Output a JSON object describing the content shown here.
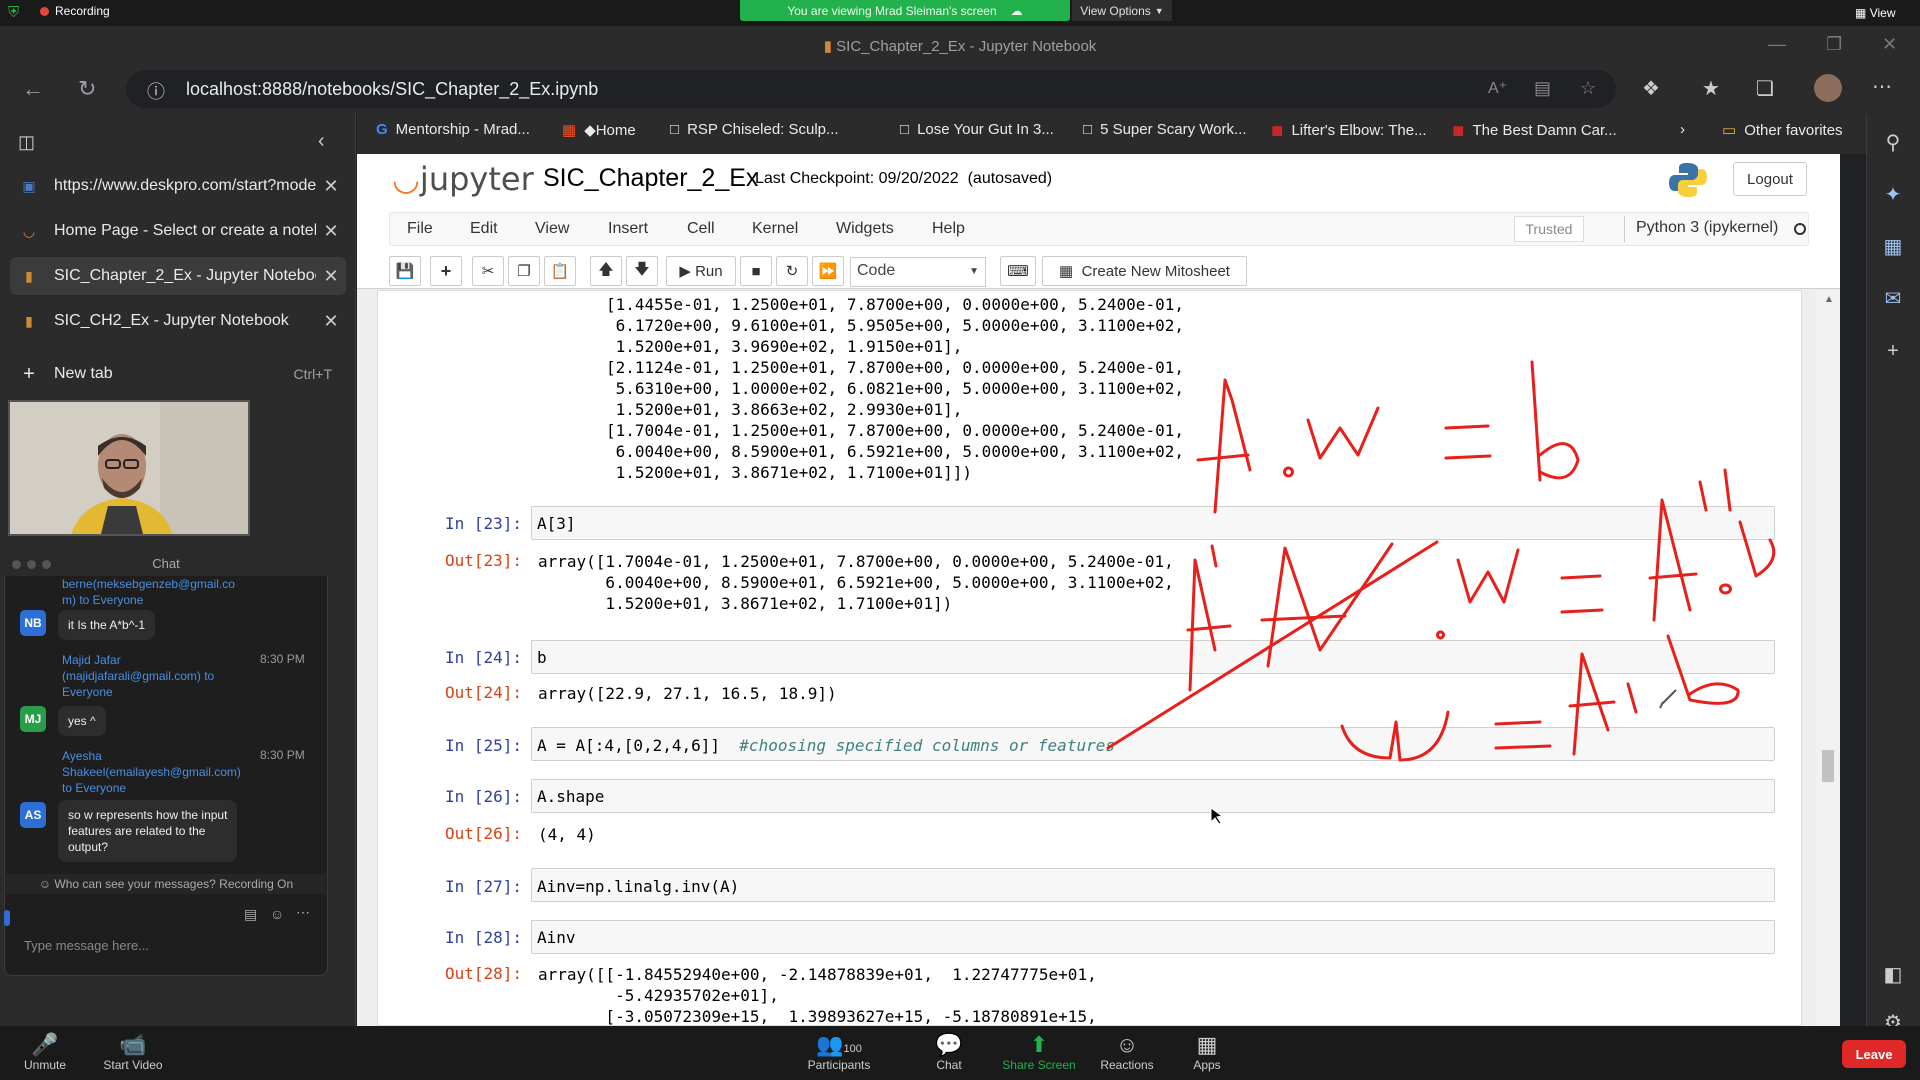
{
  "zoom": {
    "recording": "Recording",
    "viewing": "You are viewing Mrad Sleiman's screen",
    "view_options": "View Options",
    "view": "View",
    "bottom": {
      "unmute": "Unmute",
      "start_video": "Start Video",
      "participants": "Participants",
      "participants_count": "100",
      "chat": "Chat",
      "share_screen": "Share Screen",
      "reactions": "Reactions",
      "apps": "Apps",
      "leave": "Leave"
    }
  },
  "browser": {
    "window_title": "SIC_Chapter_2_Ex - Jupyter Notebook",
    "url": "localhost:8888/notebooks/SIC_Chapter_2_Ex.ipynb",
    "tabs": [
      {
        "label": "https://www.deskpro.com/start?mode-",
        "icon": "page-icon"
      },
      {
        "label": "Home Page - Select or create a notebo",
        "icon": "jupyter-icon"
      },
      {
        "label": "SIC_Chapter_2_Ex - Jupyter Notebook",
        "icon": "notebook-icon"
      },
      {
        "label": "SIC_CH2_Ex - Jupyter Notebook",
        "icon": "notebook-icon"
      }
    ],
    "new_tab": "New tab",
    "new_tab_shortcut": "Ctrl+T",
    "favorites": [
      "Mentorship - Mrad...",
      "◆Home",
      "RSP Chiseled: Sculp...",
      "Lose Your Gut In 3...",
      "5 Super Scary Work...",
      "Lifter's Elbow: The...",
      "The Best Damn Car..."
    ],
    "other_favorites": "Other favorites"
  },
  "jupyter": {
    "logo": "jupyter",
    "notebook_name": "SIC_Chapter_2_Ex",
    "checkpoint": "Last Checkpoint: 09/20/2022  (autosaved)",
    "logout": "Logout",
    "menu": [
      "File",
      "Edit",
      "View",
      "Insert",
      "Cell",
      "Kernel",
      "Widgets",
      "Help"
    ],
    "trusted": "Trusted",
    "kernel": "Python 3 (ipykernel)",
    "run_label": "Run",
    "cell_type": "Code",
    "mitosheet": "Create New Mitosheet"
  },
  "notebook": {
    "top_output": "[1.4455e-01, 1.2500e+01, 7.8700e+00, 0.0000e+00, 5.2400e-01,\n 6.1720e+00, 9.6100e+01, 5.9505e+00, 5.0000e+00, 3.1100e+02,\n 1.5200e+01, 3.9690e+02, 1.9150e+01],\n[2.1124e-01, 1.2500e+01, 7.8700e+00, 0.0000e+00, 5.2400e-01,\n 5.6310e+00, 1.0000e+02, 6.0821e+00, 5.0000e+00, 3.1100e+02,\n 1.5200e+01, 3.8663e+02, 2.9930e+01],\n[1.7004e-01, 1.2500e+01, 7.8700e+00, 0.0000e+00, 5.2400e-01,\n 6.0040e+00, 8.5900e+01, 6.5921e+00, 5.0000e+00, 3.1100e+02,\n 1.5200e+01, 3.8671e+02, 1.7100e+01]])",
    "in23": "In [23]:",
    "code23": "A[3]",
    "out23": "Out[23]:",
    "result23": "array([1.7004e-01, 1.2500e+01, 7.8700e+00, 0.0000e+00, 5.2400e-01,\n       6.0040e+00, 8.5900e+01, 6.5921e+00, 5.0000e+00, 3.1100e+02,\n       1.5200e+01, 3.8671e+02, 1.7100e+01])",
    "in24": "In [24]:",
    "code24": "b",
    "out24": "Out[24]:",
    "result24": "array([22.9, 27.1, 16.5, 18.9])",
    "in25": "In [25]:",
    "code25": "A = A[:4,[0,2,4,6]]  ",
    "comment25": "#choosing specified columns or features",
    "in26": "In [26]:",
    "code26": "A.shape",
    "out26": "Out[26]:",
    "result26": "(4, 4)",
    "in27": "In [27]:",
    "code27": "Ainv=np.linalg.inv(A)",
    "in28": "In [28]:",
    "code28": "Ainv",
    "out28": "Out[28]:",
    "result28": "array([[-1.84552940e+00, -2.14878839e+01,  1.22747775e+01,\n        -5.42935702e+01],\n       [-3.05072309e+15,  1.39893627e+15, -5.18780891e+15,"
  },
  "chat": {
    "title": "Chat",
    "partial_sender": "berne(meksebgenzeb@gmail.co\nm) to Everyone",
    "messages": [
      {
        "initials": "NB",
        "color": "#2d6fd6",
        "sender": "",
        "time": "",
        "text": "it Is the A*b^-1"
      },
      {
        "initials": "MJ",
        "color": "#2a9d4a",
        "sender": "Majid Jafar\n(majidjafarali@gmail.com) to\nEveryone",
        "time": "8:30 PM",
        "text": "yes ^"
      },
      {
        "initials": "AS",
        "color": "#2d6fd6",
        "sender": "Ayesha\nShakeel(emailayesh@gmail.com)\nto Everyone",
        "time": "8:30 PM",
        "text": "so w represents how the input\nfeatures are related to the\noutput?"
      }
    ],
    "privacy": "Who can see your messages? Recording On",
    "placeholder": "Type message here..."
  },
  "colors": {
    "ink": "#e8201c",
    "jupyter_orange": "#f37726",
    "zoom_green": "#23b14d",
    "leave_red": "#e02828"
  }
}
